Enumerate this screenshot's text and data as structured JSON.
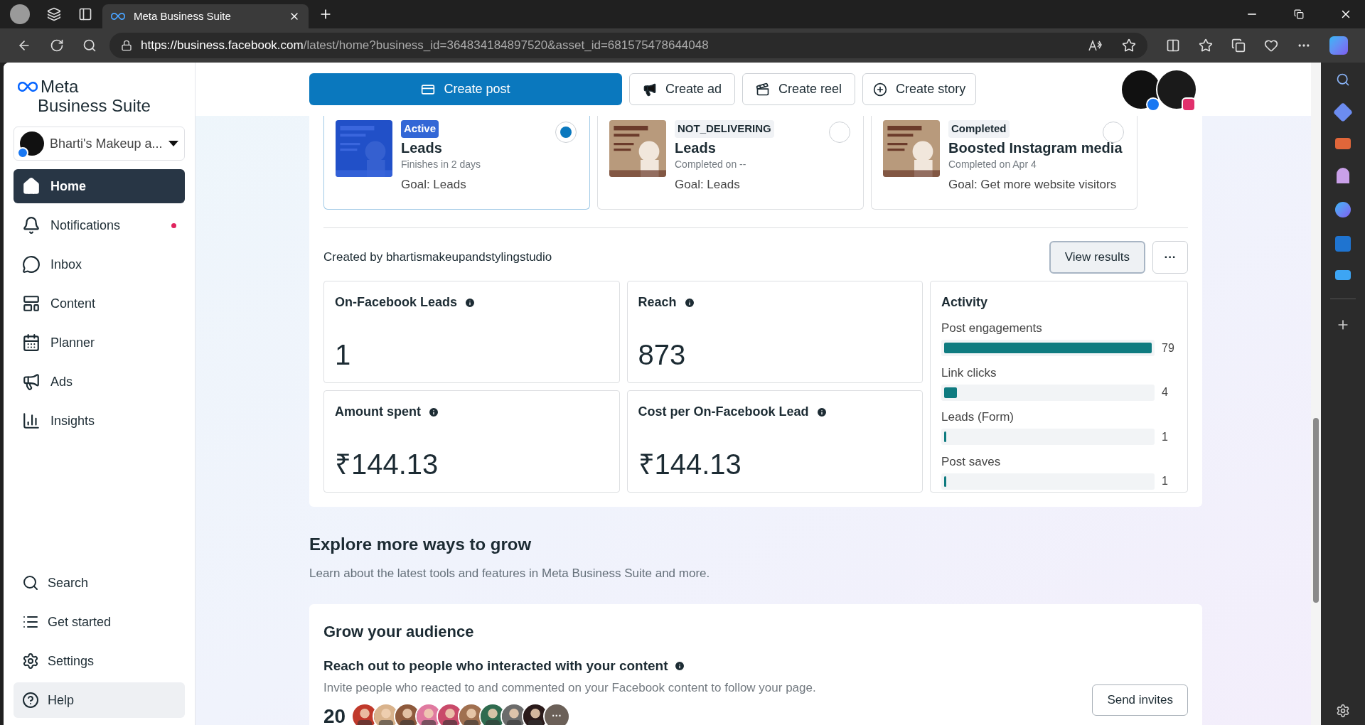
{
  "browser": {
    "tab_title": "Meta Business Suite",
    "url_host": "https://business.facebook.com",
    "url_path": "/latest/home?business_id=364834184897520&asset_id=681575478644048"
  },
  "sidebar": {
    "logo_line1": "Meta",
    "logo_line2": "Business Suite",
    "account": "Bharti's Makeup a...",
    "nav": [
      {
        "label": "Home",
        "selected": true,
        "badge": false
      },
      {
        "label": "Notifications",
        "selected": false,
        "badge": true
      },
      {
        "label": "Inbox",
        "selected": false,
        "badge": false
      },
      {
        "label": "Content",
        "selected": false,
        "badge": false
      },
      {
        "label": "Planner",
        "selected": false,
        "badge": false
      },
      {
        "label": "Ads",
        "selected": false,
        "badge": false
      },
      {
        "label": "Insights",
        "selected": false,
        "badge": false
      }
    ],
    "bottom_nav": [
      {
        "label": "Search",
        "selected": false
      },
      {
        "label": "Get started",
        "selected": false
      },
      {
        "label": "Settings",
        "selected": false
      },
      {
        "label": "Help",
        "selected": true
      }
    ]
  },
  "toolbar": {
    "buttons": [
      {
        "label": "Create post",
        "kind": "primary"
      },
      {
        "label": "Create ad",
        "kind": "ad"
      },
      {
        "label": "Create reel",
        "kind": "reel"
      },
      {
        "label": "Create story",
        "kind": "story"
      }
    ]
  },
  "campaigns": [
    {
      "status": "Active",
      "title": "Leads",
      "subtitle": "Finishes in 2 days",
      "goal": "Goal: Leads",
      "selected": true
    },
    {
      "status": "NOT_DELIVERING",
      "title": "Leads",
      "subtitle": "Completed on --",
      "goal": "Goal: Leads",
      "selected": false
    },
    {
      "status": "Completed",
      "title": "Boosted Instagram media",
      "subtitle": "Completed on Apr 4",
      "goal": "Goal: Get more website visitors",
      "selected": false
    }
  ],
  "created_by": "Created by bhartismakeupandstylingstudio",
  "view_results": "View results",
  "more": "···",
  "metrics": [
    {
      "label": "On-Facebook Leads",
      "value": "1"
    },
    {
      "label": "Reach",
      "value": "873"
    },
    {
      "label": "Amount spent",
      "value": "₹144.13"
    },
    {
      "label": "Cost per On-Facebook Lead",
      "value": "₹144.13"
    }
  ],
  "activity": {
    "title": "Activity",
    "items": [
      {
        "label": "Post engagements",
        "value": "79",
        "level": 1
      },
      {
        "label": "Link clicks",
        "value": "4",
        "level": 0.06
      },
      {
        "label": "Leads (Form)",
        "value": "1",
        "level": 0.01
      },
      {
        "label": "Post saves",
        "value": "1",
        "level": 0.01
      }
    ]
  },
  "explore": {
    "title": "Explore more ways to grow",
    "subtitle": "Learn about the latest tools and features in Meta Business Suite and more."
  },
  "grow": {
    "title": "Grow your audience",
    "heading": "Reach out to people who interacted with your content",
    "description": "Invite people who reacted to and commented on your Facebook content to follow your page.",
    "count": "20",
    "button": "Send invites",
    "more": "···"
  }
}
